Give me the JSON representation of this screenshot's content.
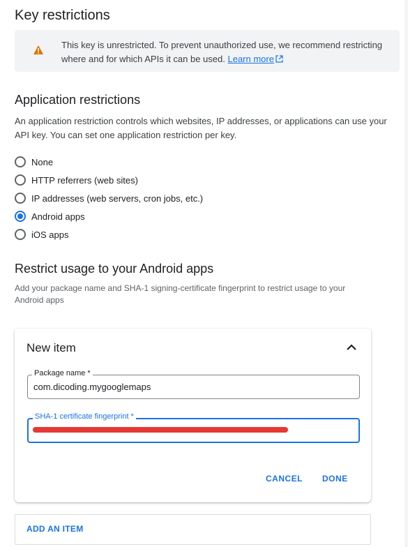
{
  "key_restrictions": {
    "title": "Key restrictions",
    "banner_text": "This key is unrestricted. To prevent unauthorized use, we recommend restricting where and for which APIs it can be used.",
    "learn_more": "Learn more"
  },
  "application_restrictions": {
    "title": "Application restrictions",
    "description": "An application restriction controls which websites, IP addresses, or applications can use your API key. You can set one application restriction per key.",
    "options": [
      {
        "label": "None",
        "checked": false
      },
      {
        "label": "HTTP referrers (web sites)",
        "checked": false
      },
      {
        "label": "IP addresses (web servers, cron jobs, etc.)",
        "checked": false
      },
      {
        "label": "Android apps",
        "checked": true
      },
      {
        "label": "iOS apps",
        "checked": false
      }
    ]
  },
  "android": {
    "title": "Restrict usage to your Android apps",
    "description": "Add your package name and SHA-1 signing-certificate fingerprint to restrict usage to your Android apps"
  },
  "new_item": {
    "title": "New item",
    "package_label": "Package name *",
    "package_value": "com.dicoding.mygooglemaps",
    "sha_label": "SHA-1 certificate fingerprint *",
    "cancel": "CANCEL",
    "done": "DONE"
  },
  "add_item": "ADD AN ITEM",
  "colors": {
    "accent": "#1a73e8",
    "warning": "#e37400",
    "redaction": "#e53935"
  }
}
